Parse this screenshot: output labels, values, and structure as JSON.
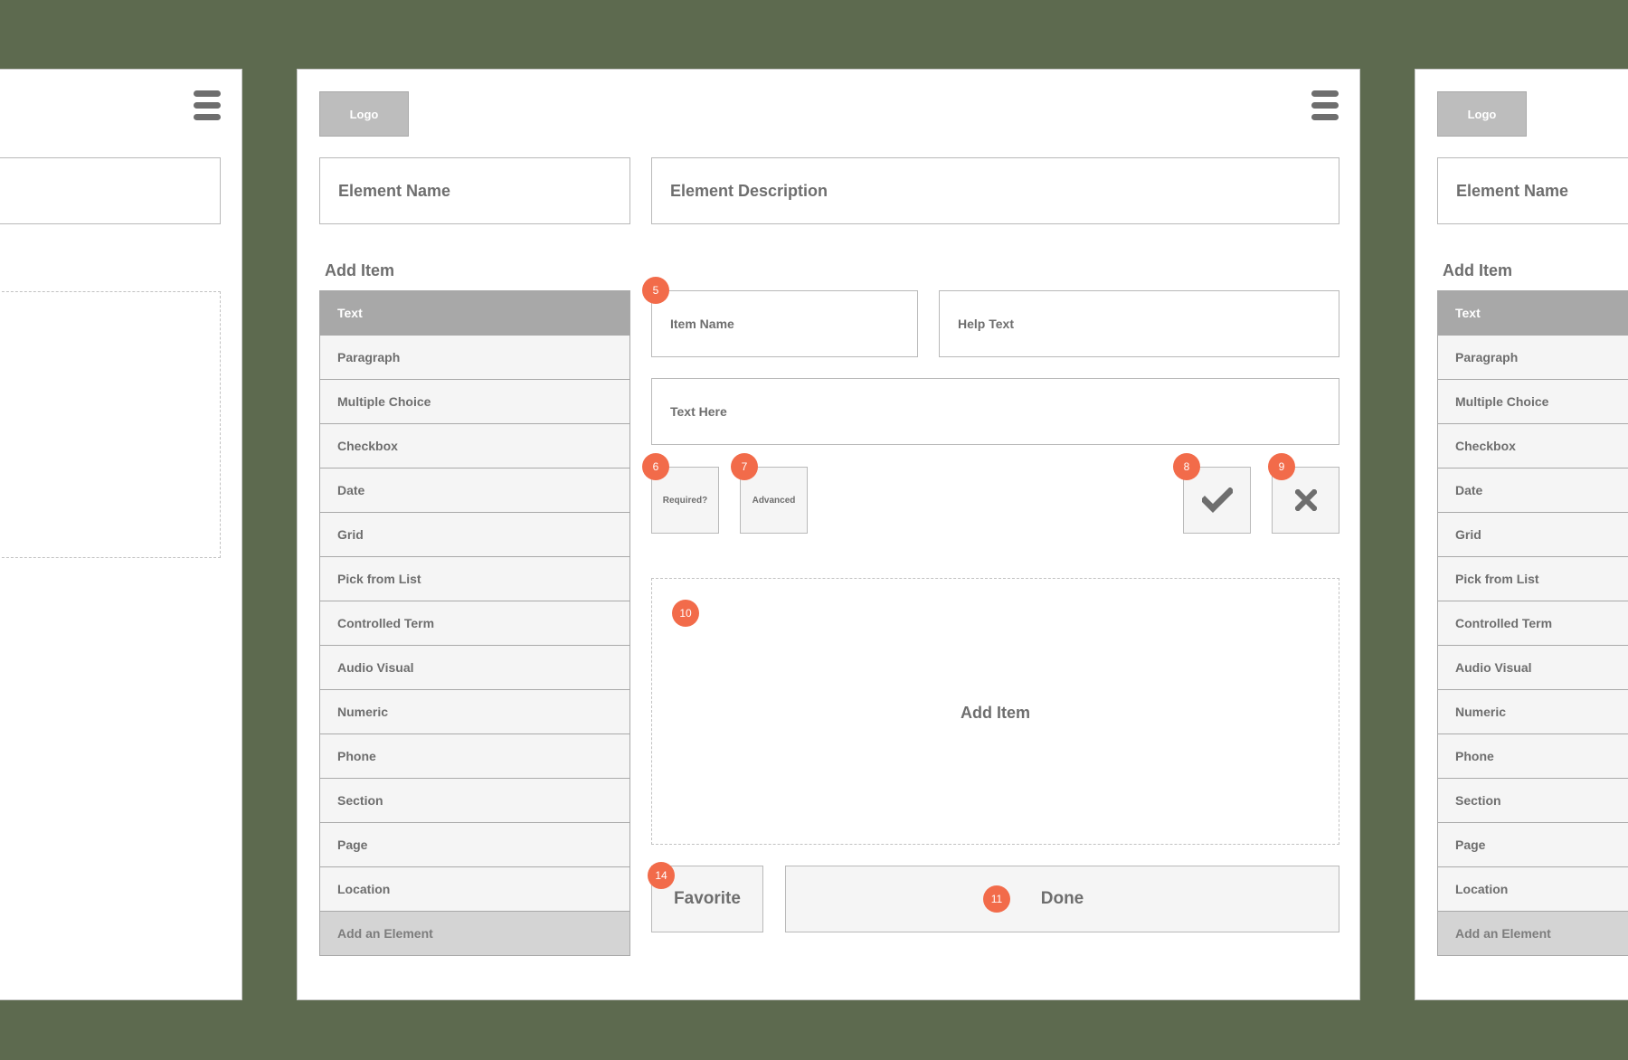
{
  "colors": {
    "background": "#5d6a4f",
    "badge": "#f26b4a",
    "selected": "#a8a8a8"
  },
  "logo": "Logo",
  "menu_icon": "hamburger-icon",
  "element_name_placeholder": "Element Name",
  "element_description_placeholder": "Element Description",
  "add_item_heading": "Add Item",
  "item_types": [
    "Text",
    "Paragraph",
    "Multiple Choice",
    "Checkbox",
    "Date",
    "Grid",
    "Pick from List",
    "Controlled Term",
    "Audio Visual",
    "Numeric",
    "Phone",
    "Section",
    "Page",
    "Location"
  ],
  "selected_item_type": "Text",
  "add_element_label": "Add an Element",
  "editor": {
    "item_name_placeholder": "Item Name",
    "help_text_placeholder": "Help Text",
    "text_here_placeholder": "Text Here",
    "required_label": "Required?",
    "advanced_label": "Advanced",
    "confirm_icon": "checkmark-icon",
    "cancel_icon": "close-icon",
    "add_item_area_label": "Add Item",
    "favorite_label": "Favorite",
    "done_label": "Done"
  },
  "badges": {
    "item_name": "5",
    "required": "6",
    "advanced": "7",
    "confirm": "8",
    "cancel": "9",
    "add_item_area": "10",
    "done": "11",
    "favorite": "14"
  }
}
